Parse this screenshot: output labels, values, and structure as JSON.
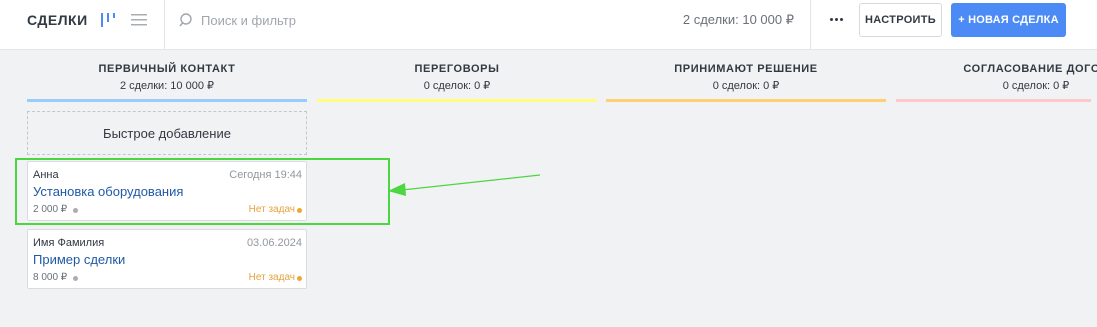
{
  "header": {
    "title": "СДЕЛКИ",
    "search_placeholder": "Поиск и фильтр",
    "summary": "2 сделки: 10 000 ₽",
    "settings_label": "НАСТРОИТЬ",
    "new_deal_label": "+ НОВАЯ СДЕЛКА"
  },
  "columns": [
    {
      "name": "ПЕРВИЧНЫЙ КОНТАКТ",
      "count": "2 сделки: 10 000 ₽",
      "color": "#99ccfd"
    },
    {
      "name": "ПЕРЕГОВОРЫ",
      "count": "0 сделок: 0 ₽",
      "color": "#fffd7f"
    },
    {
      "name": "ПРИНИМАЮТ РЕШЕНИЕ",
      "count": "0 сделок: 0 ₽",
      "color": "#fed073"
    },
    {
      "name": "СОГЛАСОВАНИЕ ДОГОВ",
      "count": "0 сделок: 0 ₽",
      "color": "#ffc8c8"
    }
  ],
  "quick_add_label": "Быстрое добавление",
  "cards": [
    {
      "contact": "Анна",
      "date": "Сегодня 19:44",
      "deal": "Установка оборудования",
      "price": "2 000 ₽",
      "tasks": "Нет задач"
    },
    {
      "contact": "Имя Фамилия",
      "date": "03.06.2024",
      "deal": "Пример сделки",
      "price": "8 000 ₽",
      "tasks": "Нет задач"
    }
  ],
  "icons": {
    "pipeline_view": "pipeline-view-icon",
    "list_view": "list-view-icon",
    "search": "search-icon",
    "more": "more-icon"
  },
  "colors": {
    "accent": "#4c8bf5",
    "highlight": "#4cd640",
    "deal_link": "#1f5aa6",
    "no_tasks": "#e6a23c"
  }
}
